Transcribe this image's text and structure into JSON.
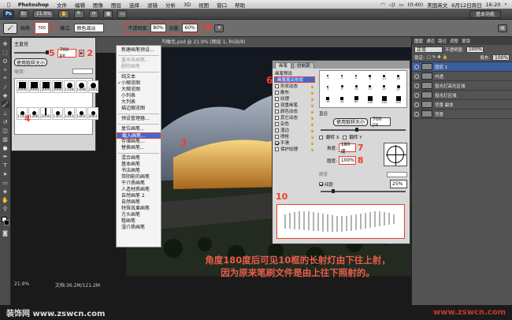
{
  "menubar": {
    "app": "Photoshop",
    "items": [
      "文件",
      "编辑",
      "图像",
      "图层",
      "选择",
      "滤镜",
      "分析",
      "3D",
      "视图",
      "窗口",
      "帮助"
    ],
    "battery": "(0:40)",
    "input_method": "美国英文",
    "date": "6月12日周日",
    "time": "16:20"
  },
  "appbar": {
    "zoom": "21.9%",
    "workspace": "基本功能"
  },
  "options": {
    "brush_size": "700",
    "mode_label": "模式:",
    "mode_value": "颜色减淡",
    "opacity_label": "不透明度:",
    "opacity_value": "80%",
    "flow_label": "流量:",
    "flow_value": "60%"
  },
  "annotations": {
    "n2": "2",
    "n3": "3",
    "n4": "4",
    "n5": "5",
    "n6": "6",
    "n7": "7",
    "n8": "8",
    "n9": "9",
    "n10": "10"
  },
  "picker": {
    "master_diameter_label": "主直径",
    "size_field": "700 px",
    "use_sample_btn": "使用取样大小",
    "hardness_label": "硬度:",
    "brush_numbers": [
      "2000",
      "2000",
      "2000",
      "2000",
      "1228",
      "1408",
      "2181",
      "1142",
      "1306",
      "2000",
      "1361",
      "1443",
      "1402",
      "2081"
    ]
  },
  "menu": {
    "items": [
      {
        "label": "新建画笔预设...",
        "state": "normal"
      },
      {
        "sep": true
      },
      {
        "label": "重命名画笔...",
        "state": "disabled"
      },
      {
        "label": "删除画笔",
        "state": "disabled"
      },
      {
        "sep": true
      },
      {
        "label": "纯文本",
        "state": "normal"
      },
      {
        "label": "小缩览图",
        "state": "checked"
      },
      {
        "label": "大缩览图",
        "state": "normal"
      },
      {
        "label": "小列表",
        "state": "normal"
      },
      {
        "label": "大列表",
        "state": "normal"
      },
      {
        "label": "描边缩览图",
        "state": "normal"
      },
      {
        "sep": true
      },
      {
        "label": "预设管理器...",
        "state": "normal"
      },
      {
        "sep": true
      },
      {
        "label": "复位画笔...",
        "state": "normal"
      },
      {
        "label": "载入画笔...",
        "state": "selected"
      },
      {
        "label": "存储画笔...",
        "state": "normal"
      },
      {
        "label": "替换画笔...",
        "state": "normal"
      },
      {
        "sep": true
      },
      {
        "label": "混合画笔",
        "state": "normal"
      },
      {
        "label": "基本画笔",
        "state": "normal"
      },
      {
        "label": "书法画笔",
        "state": "normal"
      },
      {
        "label": "带阴影的画笔",
        "state": "normal"
      },
      {
        "label": "干介质画笔",
        "state": "normal"
      },
      {
        "label": "人造材质画笔",
        "state": "normal"
      },
      {
        "label": "自然画笔 2",
        "state": "normal"
      },
      {
        "label": "自然画笔",
        "state": "normal"
      },
      {
        "label": "特殊效果画笔",
        "state": "normal"
      },
      {
        "label": "方头画笔",
        "state": "normal"
      },
      {
        "label": "粗画笔",
        "state": "normal"
      },
      {
        "label": "湿介质画笔",
        "state": "normal"
      }
    ]
  },
  "document": {
    "tab_title": "鸟瞰北.psd @ 21.9% (图层 1, RGB/8)",
    "status_zoom": "21.9%",
    "status_doc": "文档:36.2M/121.2M"
  },
  "brush_dialog": {
    "tabs": [
      "画笔",
      "仿制源"
    ],
    "preset_label": "画笔预设",
    "tip_shape": "画笔笔尖形状",
    "options": [
      {
        "label": "形状动态",
        "on": false
      },
      {
        "label": "散布",
        "on": false
      },
      {
        "label": "纹理",
        "on": false
      },
      {
        "label": "双重画笔",
        "on": false
      },
      {
        "label": "颜色动态",
        "on": false
      },
      {
        "label": "其它动态",
        "on": false
      },
      {
        "label": "杂色",
        "on": false
      },
      {
        "label": "湿边",
        "on": false
      },
      {
        "label": "喷枪",
        "on": false
      },
      {
        "label": "平滑",
        "on": true
      },
      {
        "label": "保护纹理",
        "on": false
      }
    ],
    "diameter_label": "直径",
    "use_sample_btn": "使用取样大小",
    "diameter_value": "700 px",
    "flip_x": "翻转 X",
    "flip_y": "翻转 Y",
    "angle_label": "角度:",
    "angle_value": "180度",
    "roundness_label": "圆度:",
    "roundness_value": "100%",
    "hardness_label": "硬度",
    "spacing_label": "间距",
    "spacing_value": "25%",
    "tip_numbers": [
      "1",
      "3",
      "5",
      "9",
      "13",
      "19",
      "5",
      "9",
      "13",
      "17",
      "21",
      "27",
      "35",
      "45",
      "65",
      "100",
      "200",
      "300"
    ]
  },
  "layers": {
    "tabs": [
      "图层",
      "通道",
      "路径",
      "调整",
      "蒙版"
    ],
    "mode": "正常",
    "opacity_label": "不透明度:",
    "opacity_value": "100%",
    "lock_label": "锁定:",
    "fill_label": "填充:",
    "fill_value": "100%",
    "list": [
      {
        "name": "图层 1",
        "selected": true
      },
      {
        "name": "内透",
        "selected": false
      },
      {
        "name": "投光灯高光区域",
        "selected": false
      },
      {
        "name": "投光灯区域",
        "selected": false
      },
      {
        "name": "背景 副本",
        "selected": false
      },
      {
        "name": "背景",
        "selected": false
      }
    ]
  },
  "caption": {
    "line1": "角度180度后可见10框的长射灯由下往上射，",
    "line2": "因为原来笔刷文件是由上往下照射的。"
  },
  "footer": {
    "left": "装饰网 www.zswcn.com",
    "right": "www.zswcn.com"
  },
  "colors": {
    "accent_red": "#e8402a",
    "menu_highlight": "#3d6bd6",
    "caption": "#e85c4a"
  }
}
